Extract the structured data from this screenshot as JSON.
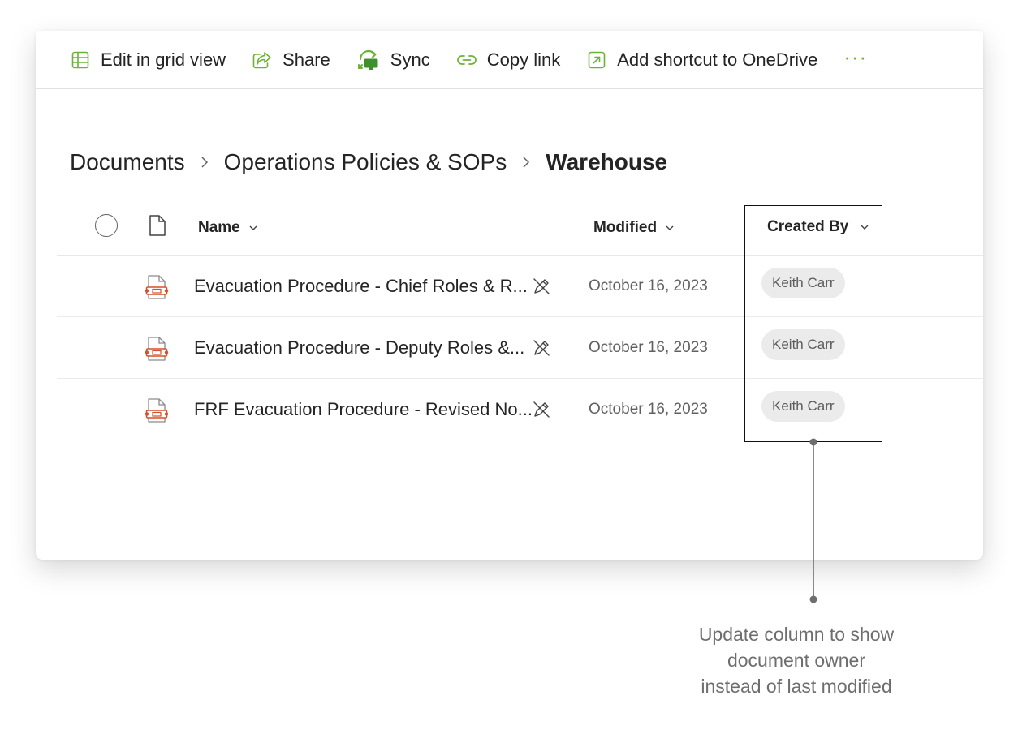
{
  "command_bar": {
    "items": [
      {
        "label": "Edit in grid view",
        "icon": "grid-icon"
      },
      {
        "label": "Share",
        "icon": "share-icon"
      },
      {
        "label": "Sync",
        "icon": "sync-icon"
      },
      {
        "label": "Copy link",
        "icon": "link-icon"
      },
      {
        "label": "Add shortcut to OneDrive",
        "icon": "shortcut-icon"
      }
    ],
    "more_label": "···",
    "accent_color": "#6bb236"
  },
  "breadcrumb": {
    "items": [
      "Documents",
      "Operations Policies & SOPs"
    ],
    "current": "Warehouse"
  },
  "table": {
    "columns": {
      "name": "Name",
      "modified": "Modified",
      "created_by": "Created By"
    },
    "rows": [
      {
        "name": "Evacuation Procedure - Chief Roles & R...",
        "modified": "October 16, 2023",
        "created_by": "Keith Carr",
        "file_icon": "powerpoint-file-icon"
      },
      {
        "name": "Evacuation Procedure - Deputy Roles &...",
        "modified": "October 16, 2023",
        "created_by": "Keith Carr",
        "file_icon": "powerpoint-file-icon"
      },
      {
        "name": "FRF Evacuation Procedure - Revised No...",
        "modified": "October 16, 2023",
        "created_by": "Keith Carr",
        "file_icon": "powerpoint-file-icon"
      }
    ]
  },
  "annotation": {
    "line1": "Update column to show",
    "line2": "document owner",
    "line3": "instead of last modified"
  }
}
